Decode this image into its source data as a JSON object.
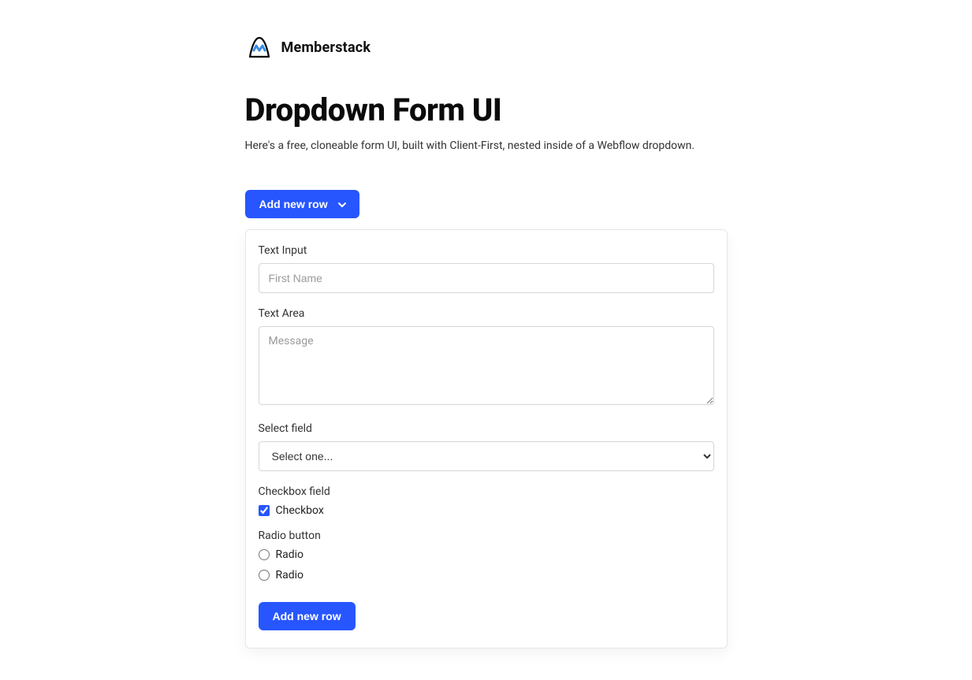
{
  "brand": {
    "name": "Memberstack"
  },
  "header": {
    "title": "Dropdown Form UI",
    "subtitle": "Here's a free, cloneable form UI, built with Client-First, nested inside of a Webflow dropdown."
  },
  "dropdown": {
    "toggle_label": "Add new row"
  },
  "form": {
    "text_input": {
      "label": "Text Input",
      "placeholder": "First Name",
      "value": ""
    },
    "textarea": {
      "label": "Text Area",
      "placeholder": "Message",
      "value": ""
    },
    "select": {
      "label": "Select field",
      "placeholder": "Select one...",
      "value": ""
    },
    "checkbox": {
      "label": "Checkbox field",
      "option_label": "Checkbox",
      "checked": true
    },
    "radio": {
      "label": "Radio button",
      "options": [
        "Radio",
        "Radio"
      ]
    },
    "submit_label": "Add new row"
  },
  "colors": {
    "accent": "#2756ff"
  }
}
